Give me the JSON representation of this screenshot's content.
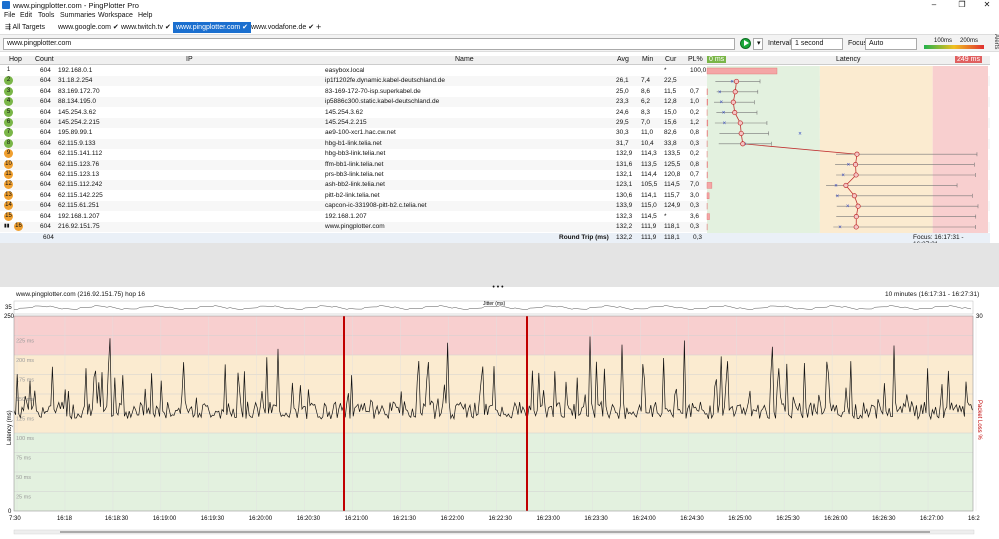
{
  "window": {
    "title": "www.pingplotter.com - PingPlotter Pro"
  },
  "menu": [
    "File",
    "Edit",
    "Tools",
    "Summaries",
    "Workspace",
    "Help"
  ],
  "tabs": [
    {
      "label": "All Targets"
    },
    {
      "label": "www.google.com"
    },
    {
      "label": "www.twitch.tv"
    },
    {
      "label": "www.pingplotter.com",
      "active": true
    },
    {
      "label": "www.vodafone.de"
    }
  ],
  "toolbar": {
    "target": "www.pingplotter.com",
    "interval_label": "Interval",
    "interval_value": "1 second",
    "focus_label": "Focus",
    "focus_value": "Auto",
    "scale_left": "100ms",
    "scale_right": "200ms",
    "alerts_label": "Alerts"
  },
  "table": {
    "headers": {
      "hop": "Hop",
      "count": "Count",
      "ip": "IP",
      "name": "Name",
      "avg": "Avg",
      "min": "Min",
      "cur": "Cur",
      "pl": "PL%",
      "scale_min": "0 ms",
      "latency": "Latency",
      "scale_max": "249 ms"
    },
    "rows": [
      {
        "hop": "1",
        "count": "604",
        "ip": "192.168.0.1",
        "name": "easybox.local",
        "avg": "",
        "min": "",
        "cur": "*",
        "pl": "100,0"
      },
      {
        "hop": "2",
        "count": "604",
        "ip": "31.18.2.254",
        "name": "ip1f1202fe.dynamic.kabel-deutschland.de",
        "avg": "26,1",
        "min": "7,4",
        "cur": "22,5",
        "pl": ""
      },
      {
        "hop": "3",
        "count": "604",
        "ip": "83.169.172.70",
        "name": "83-169-172-70-isp.superkabel.de",
        "avg": "25,0",
        "min": "8,6",
        "cur": "11,5",
        "pl": "0,7"
      },
      {
        "hop": "4",
        "count": "604",
        "ip": "88.134.195.0",
        "name": "ip5886c300.static.kabel-deutschland.de",
        "avg": "23,3",
        "min": "6,2",
        "cur": "12,8",
        "pl": "1,0"
      },
      {
        "hop": "5",
        "count": "604",
        "ip": "145.254.3.62",
        "name": "145.254.3.62",
        "avg": "24,6",
        "min": "8,3",
        "cur": "15,0",
        "pl": "0,2"
      },
      {
        "hop": "6",
        "count": "604",
        "ip": "145.254.2.215",
        "name": "145.254.2.215",
        "avg": "29,5",
        "min": "7,0",
        "cur": "15,6",
        "pl": "1,2"
      },
      {
        "hop": "7",
        "count": "604",
        "ip": "195.89.99.1",
        "name": "ae9-100-xcr1.hac.cw.net",
        "avg": "30,3",
        "min": "11,0",
        "cur": "82,6",
        "pl": "0,8"
      },
      {
        "hop": "8",
        "count": "604",
        "ip": "62.115.9.133",
        "name": "hbg-b1-link.telia.net",
        "avg": "31,7",
        "min": "10,4",
        "cur": "33,8",
        "pl": "0,3"
      },
      {
        "hop": "9",
        "count": "604",
        "ip": "62.115.141.112",
        "name": "hbg-bb3-link.telia.net",
        "avg": "132,9",
        "min": "114,3",
        "cur": "133,5",
        "pl": "0,2"
      },
      {
        "hop": "10",
        "count": "604",
        "ip": "62.115.123.76",
        "name": "ffm-bb1-link.telia.net",
        "avg": "131,6",
        "min": "113,5",
        "cur": "125,5",
        "pl": "0,8"
      },
      {
        "hop": "11",
        "count": "604",
        "ip": "62.115.123.13",
        "name": "prs-bb3-link.telia.net",
        "avg": "132,1",
        "min": "114,4",
        "cur": "120,8",
        "pl": "0,7"
      },
      {
        "hop": "12",
        "count": "604",
        "ip": "62.115.112.242",
        "name": "ash-bb2-link.telia.net",
        "avg": "123,1",
        "min": "105,5",
        "cur": "114,5",
        "pl": "7,0"
      },
      {
        "hop": "13",
        "count": "604",
        "ip": "62.115.142.225",
        "name": "pitt-b2-link.telia.net",
        "avg": "130,6",
        "min": "114,1",
        "cur": "115,7",
        "pl": "3,0"
      },
      {
        "hop": "14",
        "count": "604",
        "ip": "62.115.61.251",
        "name": "capcon-ic-331908-pitt-b2.c.telia.net",
        "avg": "133,9",
        "min": "115,0",
        "cur": "124,9",
        "pl": "0,3"
      },
      {
        "hop": "15",
        "count": "604",
        "ip": "192.168.1.207",
        "name": "192.168.1.207",
        "avg": "132,3",
        "min": "114,5",
        "cur": "*",
        "pl": "3,6"
      },
      {
        "hop": "16",
        "count": "604",
        "ip": "216.92.151.75",
        "name": "www.pingplotter.com",
        "avg": "132,2",
        "min": "111,9",
        "cur": "118,1",
        "pl": "0,3"
      }
    ],
    "summary": {
      "count": "604",
      "label": "Round Trip (ms)",
      "avg": "132,2",
      "min": "111,9",
      "cur": "118,1",
      "pl": "0,3",
      "focus": "Focus: 16:17:31 - 16:27:31"
    }
  },
  "graph": {
    "title": "www.pingplotter.com (216.92.151.75) hop 16",
    "range": "10 minutes (16:17:31 - 16:27:31)",
    "jitter_label": "Jitter (ms)",
    "jitter_ymax": "35",
    "y_axis_label": "Latency (ms)",
    "right_axis_label": "Packet Loss %",
    "y_max": "250",
    "y_min": "0",
    "right_top": "30",
    "y_ticks": [
      "225 ms",
      "200 ms",
      "175 ms",
      "150 ms",
      "125 ms",
      "100 ms",
      "75 ms",
      "50 ms",
      "25 ms"
    ],
    "x_ticks": [
      "7:30",
      "16:18",
      "16:18:30",
      "16:19:00",
      "16:19:30",
      "16:20:00",
      "16:20:30",
      "16:21:00",
      "16:21:30",
      "16:22:00",
      "16:22:30",
      "16:23:00",
      "16:23:30",
      "16:24:00",
      "16:24:30",
      "16:25:00",
      "16:25:30",
      "16:26:00",
      "16:26:30",
      "16:27:00",
      "16:2"
    ]
  },
  "colors": {
    "good": "#e3f1df",
    "warn": "#fbebd0",
    "bad": "#f8cfcf",
    "accent": "#1b6fcf",
    "loss": "#c00000",
    "hop_green": "#7ab648",
    "hop_orange": "#f0a030"
  }
}
